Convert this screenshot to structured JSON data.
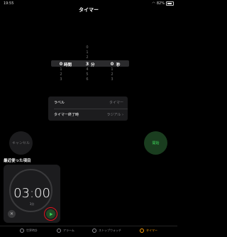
{
  "status_bar": {
    "time": "19:55",
    "battery": "82%"
  },
  "title": "タイマー",
  "picker": {
    "hours": {
      "above": [
        "",
        "",
        ""
      ],
      "selected": "0",
      "below": [
        "1",
        "2",
        "3"
      ],
      "unit": "時間"
    },
    "minutes": {
      "above": [
        "0",
        "1",
        "2"
      ],
      "selected": "3",
      "below": [
        "4",
        "5",
        "6"
      ],
      "unit": "分"
    },
    "seconds": {
      "above": [
        "",
        "",
        ""
      ],
      "selected": "0",
      "below": [
        "1",
        "2",
        "3"
      ],
      "unit": "秒"
    }
  },
  "options": {
    "label_title": "ラベル",
    "label_value": "タイマー",
    "end_title": "タイマー終了時",
    "end_value": "ラジアル ›"
  },
  "buttons": {
    "cancel": "キャンセル",
    "start": "開始"
  },
  "recent": {
    "title": "最近使った項目",
    "time": "03:00",
    "subtitle": "3分"
  },
  "tabs": [
    {
      "label": "世界時計",
      "active": false
    },
    {
      "label": "アラーム",
      "active": false
    },
    {
      "label": "ストップウォッチ",
      "active": false
    },
    {
      "label": "タイマー",
      "active": true
    }
  ],
  "colors": {
    "accent_orange": "#ff9f0a",
    "start_green": "#3fd15a",
    "highlight_red": "#e0141c"
  }
}
